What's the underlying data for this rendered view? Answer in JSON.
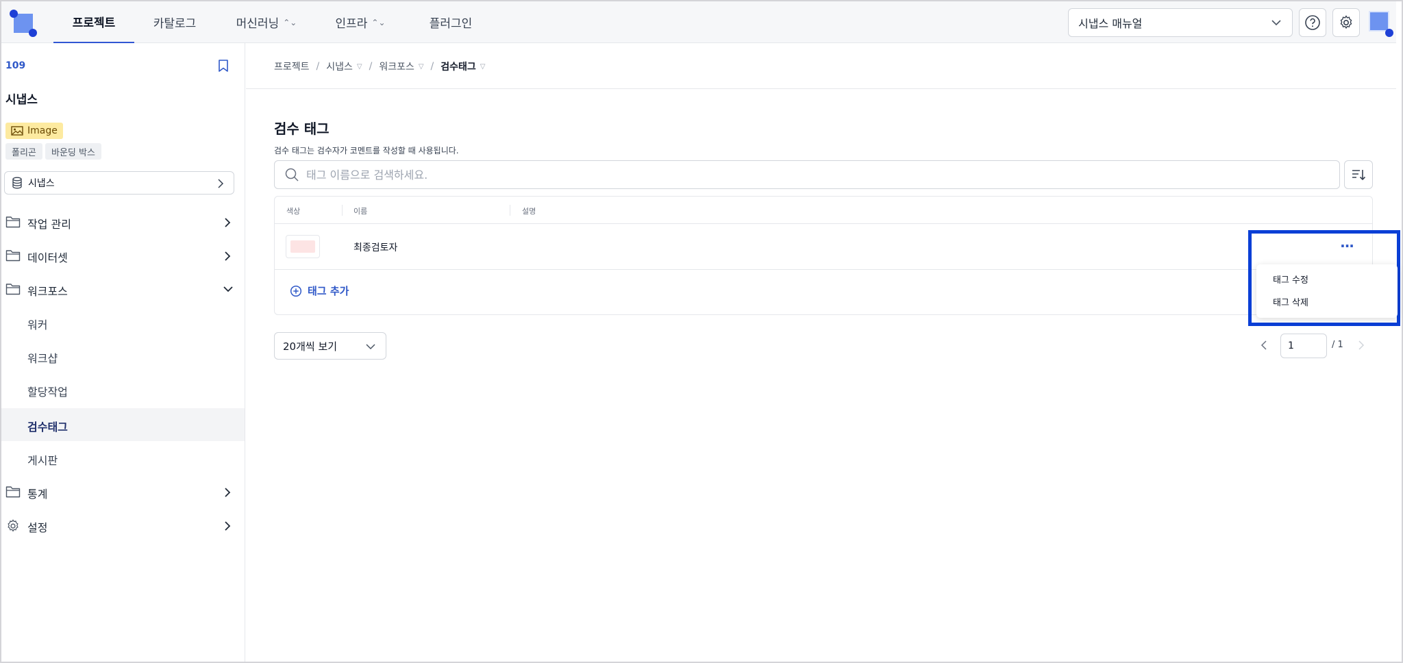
{
  "topnav": {
    "items": [
      {
        "label": "프로젝트",
        "active": true,
        "has_chevron": false
      },
      {
        "label": "카탈로그",
        "active": false,
        "has_chevron": false
      },
      {
        "label": "머신러닝",
        "active": false,
        "has_chevron": true
      },
      {
        "label": "인프라",
        "active": false,
        "has_chevron": true
      },
      {
        "label": "플러그인",
        "active": false,
        "has_chevron": false
      }
    ],
    "manual_select": "시냅스 매뉴얼"
  },
  "sidebar": {
    "project_id": "109",
    "project_name": "시냅스",
    "data_type_badge": "Image",
    "chips": [
      "폴리곤",
      "바운딩 박스"
    ],
    "dataset_label": "시냅스",
    "menu": [
      {
        "label": "작업 관리",
        "icon": "folder-icon",
        "expanded": false
      },
      {
        "label": "데이터셋",
        "icon": "folder-icon",
        "expanded": false
      },
      {
        "label": "워크포스",
        "icon": "folder-icon",
        "expanded": true
      }
    ],
    "workforce_sub": [
      {
        "label": "워커",
        "active": false
      },
      {
        "label": "워크샵",
        "active": false
      },
      {
        "label": "할당작업",
        "active": false
      },
      {
        "label": "검수태그",
        "active": true
      },
      {
        "label": "게시판",
        "active": false
      }
    ],
    "menu_bottom": [
      {
        "label": "통계",
        "icon": "folder-icon"
      },
      {
        "label": "설정",
        "icon": "gear-icon"
      }
    ]
  },
  "breadcrumb": {
    "items": [
      "프로젝트",
      "시냅스",
      "워크포스",
      "검수태그"
    ]
  },
  "page": {
    "title": "검수 태그",
    "description": "검수 태그는 검수자가 코멘트를 작성할 때 사용됩니다.",
    "search_placeholder": "태그 이름으로 검색하세요."
  },
  "table": {
    "columns": [
      "색상",
      "이름",
      "설명"
    ],
    "rows": [
      {
        "color": "#fde4e4",
        "name": "최종검토자",
        "description": ""
      }
    ],
    "add_label": "태그 추가"
  },
  "row_menu": {
    "more_label": "···",
    "options": [
      "태그 수정",
      "태그 삭제"
    ]
  },
  "pagination": {
    "page_size": "20개씩 보기",
    "current_page": "1",
    "total": "/ 1"
  },
  "colors": {
    "accent": "#2f58c8",
    "highlight": "#0a3fd6",
    "badge_image": "#fdeaa0",
    "brand": "#6d93f0"
  }
}
